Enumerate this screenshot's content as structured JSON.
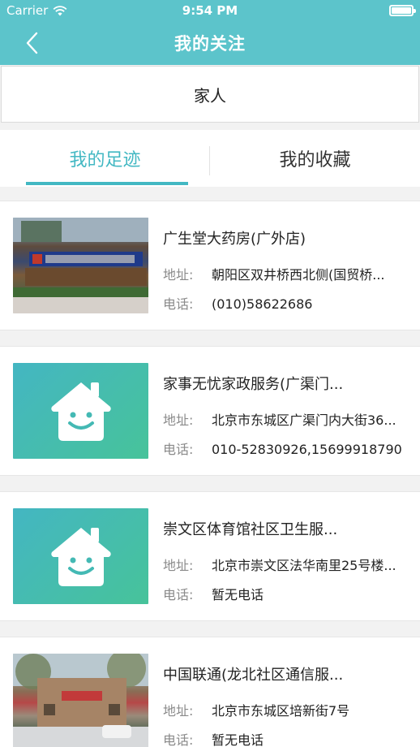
{
  "status_bar": {
    "carrier": "Carrier",
    "time": "9:54 PM"
  },
  "nav": {
    "title": "我的关注"
  },
  "family_button": {
    "label": "家人"
  },
  "tabs": [
    {
      "label": "我的足迹",
      "active": true
    },
    {
      "label": "我的收藏",
      "active": false
    }
  ],
  "labels": {
    "address": "地址:",
    "phone": "电话:"
  },
  "colors": {
    "accent": "#5cc4cb",
    "tab_active": "#43b8c3",
    "placeholder_from": "#44b6c2",
    "placeholder_to": "#47c39a"
  },
  "items": [
    {
      "name": "广生堂大药房(广外店)",
      "address": "朝阳区双井桥西北侧(国贸桥...",
      "phone": "(010)58622686",
      "image": "store-photo"
    },
    {
      "name": "家事无忧家政服务(广渠门...",
      "address": "北京市东城区广渠门内大街36...",
      "phone": "010-52830926,15699918790",
      "image": "house-placeholder-icon"
    },
    {
      "name": "崇文区体育馆社区卫生服...",
      "address": "北京市崇文区法华南里25号楼...",
      "phone": "暂无电话",
      "image": "house-placeholder-icon"
    },
    {
      "name": "中国联通(龙北社区通信服...",
      "address": "北京市东城区培新街7号",
      "phone": "暂无电话",
      "image": "street-photo"
    }
  ]
}
